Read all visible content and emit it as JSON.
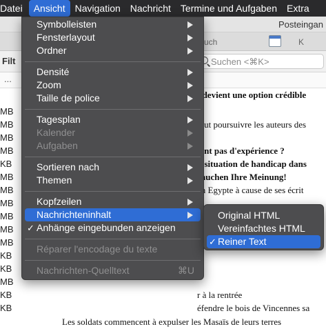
{
  "menubar": {
    "items": [
      "Datei",
      "Ansicht",
      "Navigation",
      "Nachricht",
      "Termine und Aufgaben",
      "Extra"
    ],
    "active_index": 1
  },
  "window": {
    "title": "Posteingan",
    "tabs": [
      "uch",
      "K"
    ],
    "filter_label": "Filt",
    "search_placeholder": "Suchen <⌘K>",
    "column_header_text": "..."
  },
  "message_list": {
    "rows": [
      {
        "size": "",
        "subject": "t devient une option crédible",
        "bold": true
      },
      {
        "size": "MB",
        "subject": "",
        "bold": false
      },
      {
        "size": "MB",
        "subject": "faut poursuivre les auteurs des",
        "bold": false
      },
      {
        "size": "MB",
        "subject": "",
        "bold": false
      },
      {
        "size": "MB",
        "subject": "'ont pas d'expérience ?",
        "bold": true
      },
      {
        "size": "KB",
        "subject": "n situation de handicap dans",
        "bold": true
      },
      {
        "size": "MB",
        "subject": "rauchen Ihre Meinung!",
        "bold": true
      },
      {
        "size": "MB",
        "subject": "en Egypte à cause de ses écrit",
        "bold": false
      },
      {
        "size": "MB",
        "subject": "",
        "bold": false
      },
      {
        "size": "MB",
        "subject": "",
        "bold": false
      },
      {
        "size": "MB",
        "subject": "",
        "bold": false
      },
      {
        "size": "MB",
        "subject": "",
        "bold": false
      },
      {
        "size": "KB",
        "subject": "",
        "bold": false
      },
      {
        "size": "KB",
        "subject": "",
        "bold": false
      },
      {
        "size": "MB",
        "subject": "",
        "bold": false
      },
      {
        "size": "KB",
        "subject": "r à la rentrée",
        "bold": false
      },
      {
        "size": "KB",
        "subject": "éfendre le bois de Vincennes sa",
        "bold": false
      },
      {
        "size": "",
        "subject": "Les soldats commencent à expulser les Masaïs de leurs terres",
        "bold": false
      }
    ]
  },
  "view_menu": {
    "items": [
      {
        "label": "Symbolleisten",
        "submenu": true
      },
      {
        "label": "Fensterlayout",
        "submenu": true
      },
      {
        "label": "Ordner",
        "submenu": true
      },
      {
        "label": "Densité",
        "submenu": true
      },
      {
        "label": "Zoom",
        "submenu": true
      },
      {
        "label": "Taille de police",
        "submenu": true
      },
      {
        "label": "Tagesplan",
        "submenu": true
      },
      {
        "label": "Kalender",
        "submenu": true,
        "disabled": true
      },
      {
        "label": "Aufgaben",
        "submenu": true,
        "disabled": true
      },
      {
        "label": "Sortieren nach",
        "submenu": true
      },
      {
        "label": "Themen",
        "submenu": true
      },
      {
        "label": "Kopfzeilen",
        "submenu": true
      },
      {
        "label": "Nachrichteninhalt",
        "submenu": true,
        "highlighted": true
      },
      {
        "label": "Anhänge eingebunden anzeigen",
        "checked": true
      },
      {
        "label": "Réparer l'encodage du texte",
        "disabled": true
      },
      {
        "label": "Nachrichten-Quelltext",
        "disabled": true,
        "shortcut": "⌘U"
      }
    ],
    "check_glyph": "✓"
  },
  "content_submenu": {
    "items": [
      {
        "label": "Original HTML"
      },
      {
        "label": "Vereinfachtes HTML"
      },
      {
        "label": "Reiner Text",
        "checked": true,
        "highlighted": true
      }
    ]
  },
  "colors": {
    "accent": "#2f6dd5",
    "menu_bg": "#4d4d4f",
    "menubar_bg": "#2a2a2c"
  }
}
